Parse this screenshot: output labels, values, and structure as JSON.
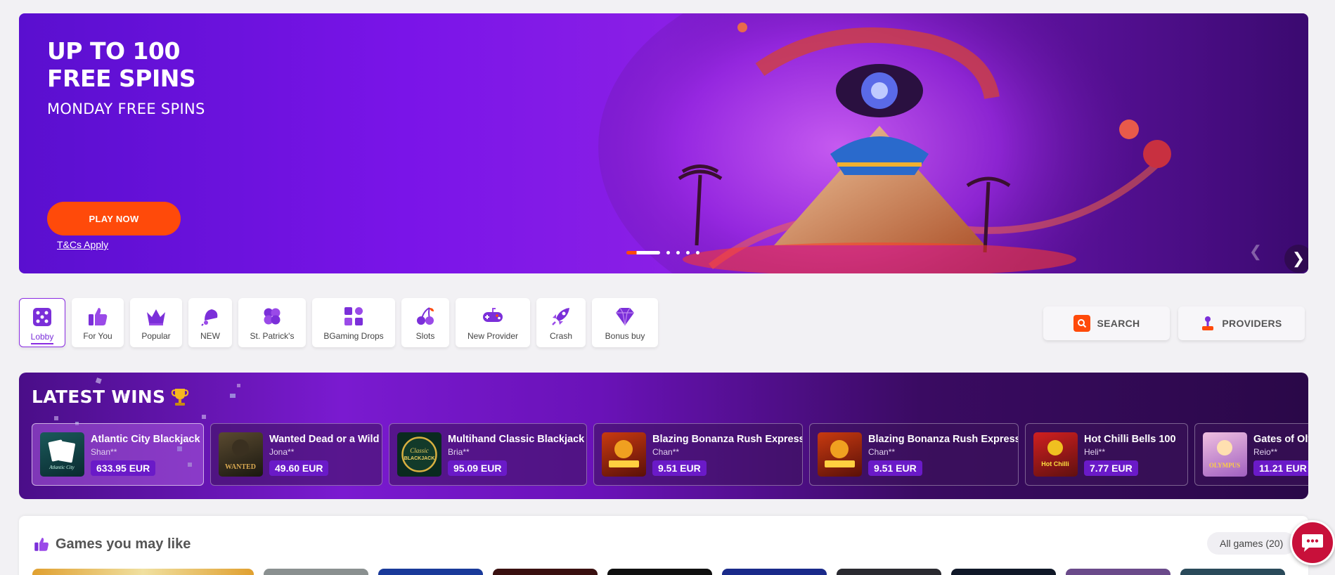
{
  "hero": {
    "title_line1": "UP TO 100",
    "title_line2": "FREE SPINS",
    "subtitle": "MONDAY FREE SPINS",
    "cta_label": "PLAY NOW",
    "terms_link": "T&Cs Apply",
    "slide_count": 5,
    "active_slide": 1
  },
  "categories": [
    {
      "label": "Lobby",
      "icon": "dice-icon",
      "active": true
    },
    {
      "label": "For You",
      "icon": "thumbs-up-icon",
      "active": false
    },
    {
      "label": "Popular",
      "icon": "crown-icon",
      "active": false
    },
    {
      "label": "NEW",
      "icon": "bell-icon",
      "active": false
    },
    {
      "label": "St. Patrick's",
      "icon": "clover-icon",
      "active": false
    },
    {
      "label": "BGaming Drops",
      "icon": "grid-icon",
      "active": false
    },
    {
      "label": "Slots",
      "icon": "cherry-icon",
      "active": false
    },
    {
      "label": "New Provider",
      "icon": "gamepad-icon",
      "active": false
    },
    {
      "label": "Crash",
      "icon": "rocket-icon",
      "active": false
    },
    {
      "label": "Bonus buy",
      "icon": "diamond-icon",
      "active": false
    }
  ],
  "toolbar": {
    "search_label": "SEARCH",
    "providers_label": "PROVIDERS"
  },
  "latest_wins": {
    "title": "LATEST WINS",
    "items": [
      {
        "game": "Atlantic City Blackjack",
        "user": "Shan**",
        "amount": "633.95 EUR"
      },
      {
        "game": "Wanted Dead or a Wild",
        "user": "Jona**",
        "amount": "49.60 EUR"
      },
      {
        "game": "Multihand Classic Blackjack",
        "user": "Bria**",
        "amount": "95.09 EUR"
      },
      {
        "game": "Blazing Bonanza Rush Express",
        "user": "Chan**",
        "amount": "9.51 EUR"
      },
      {
        "game": "Blazing Bonanza Rush Express",
        "user": "Chan**",
        "amount": "9.51 EUR"
      },
      {
        "game": "Hot Chilli Bells 100",
        "user": "Heli**",
        "amount": "7.77 EUR"
      },
      {
        "game": "Gates of Olympus",
        "user": "Reio**",
        "amount": "11.21 EUR"
      }
    ]
  },
  "games_you_may_like": {
    "title": "Games you may like",
    "all_games_label": "All games (20)"
  },
  "colors": {
    "accent": "#ff4a0a",
    "brand_purple": "#7a14e8",
    "chat": "#c8103a"
  }
}
